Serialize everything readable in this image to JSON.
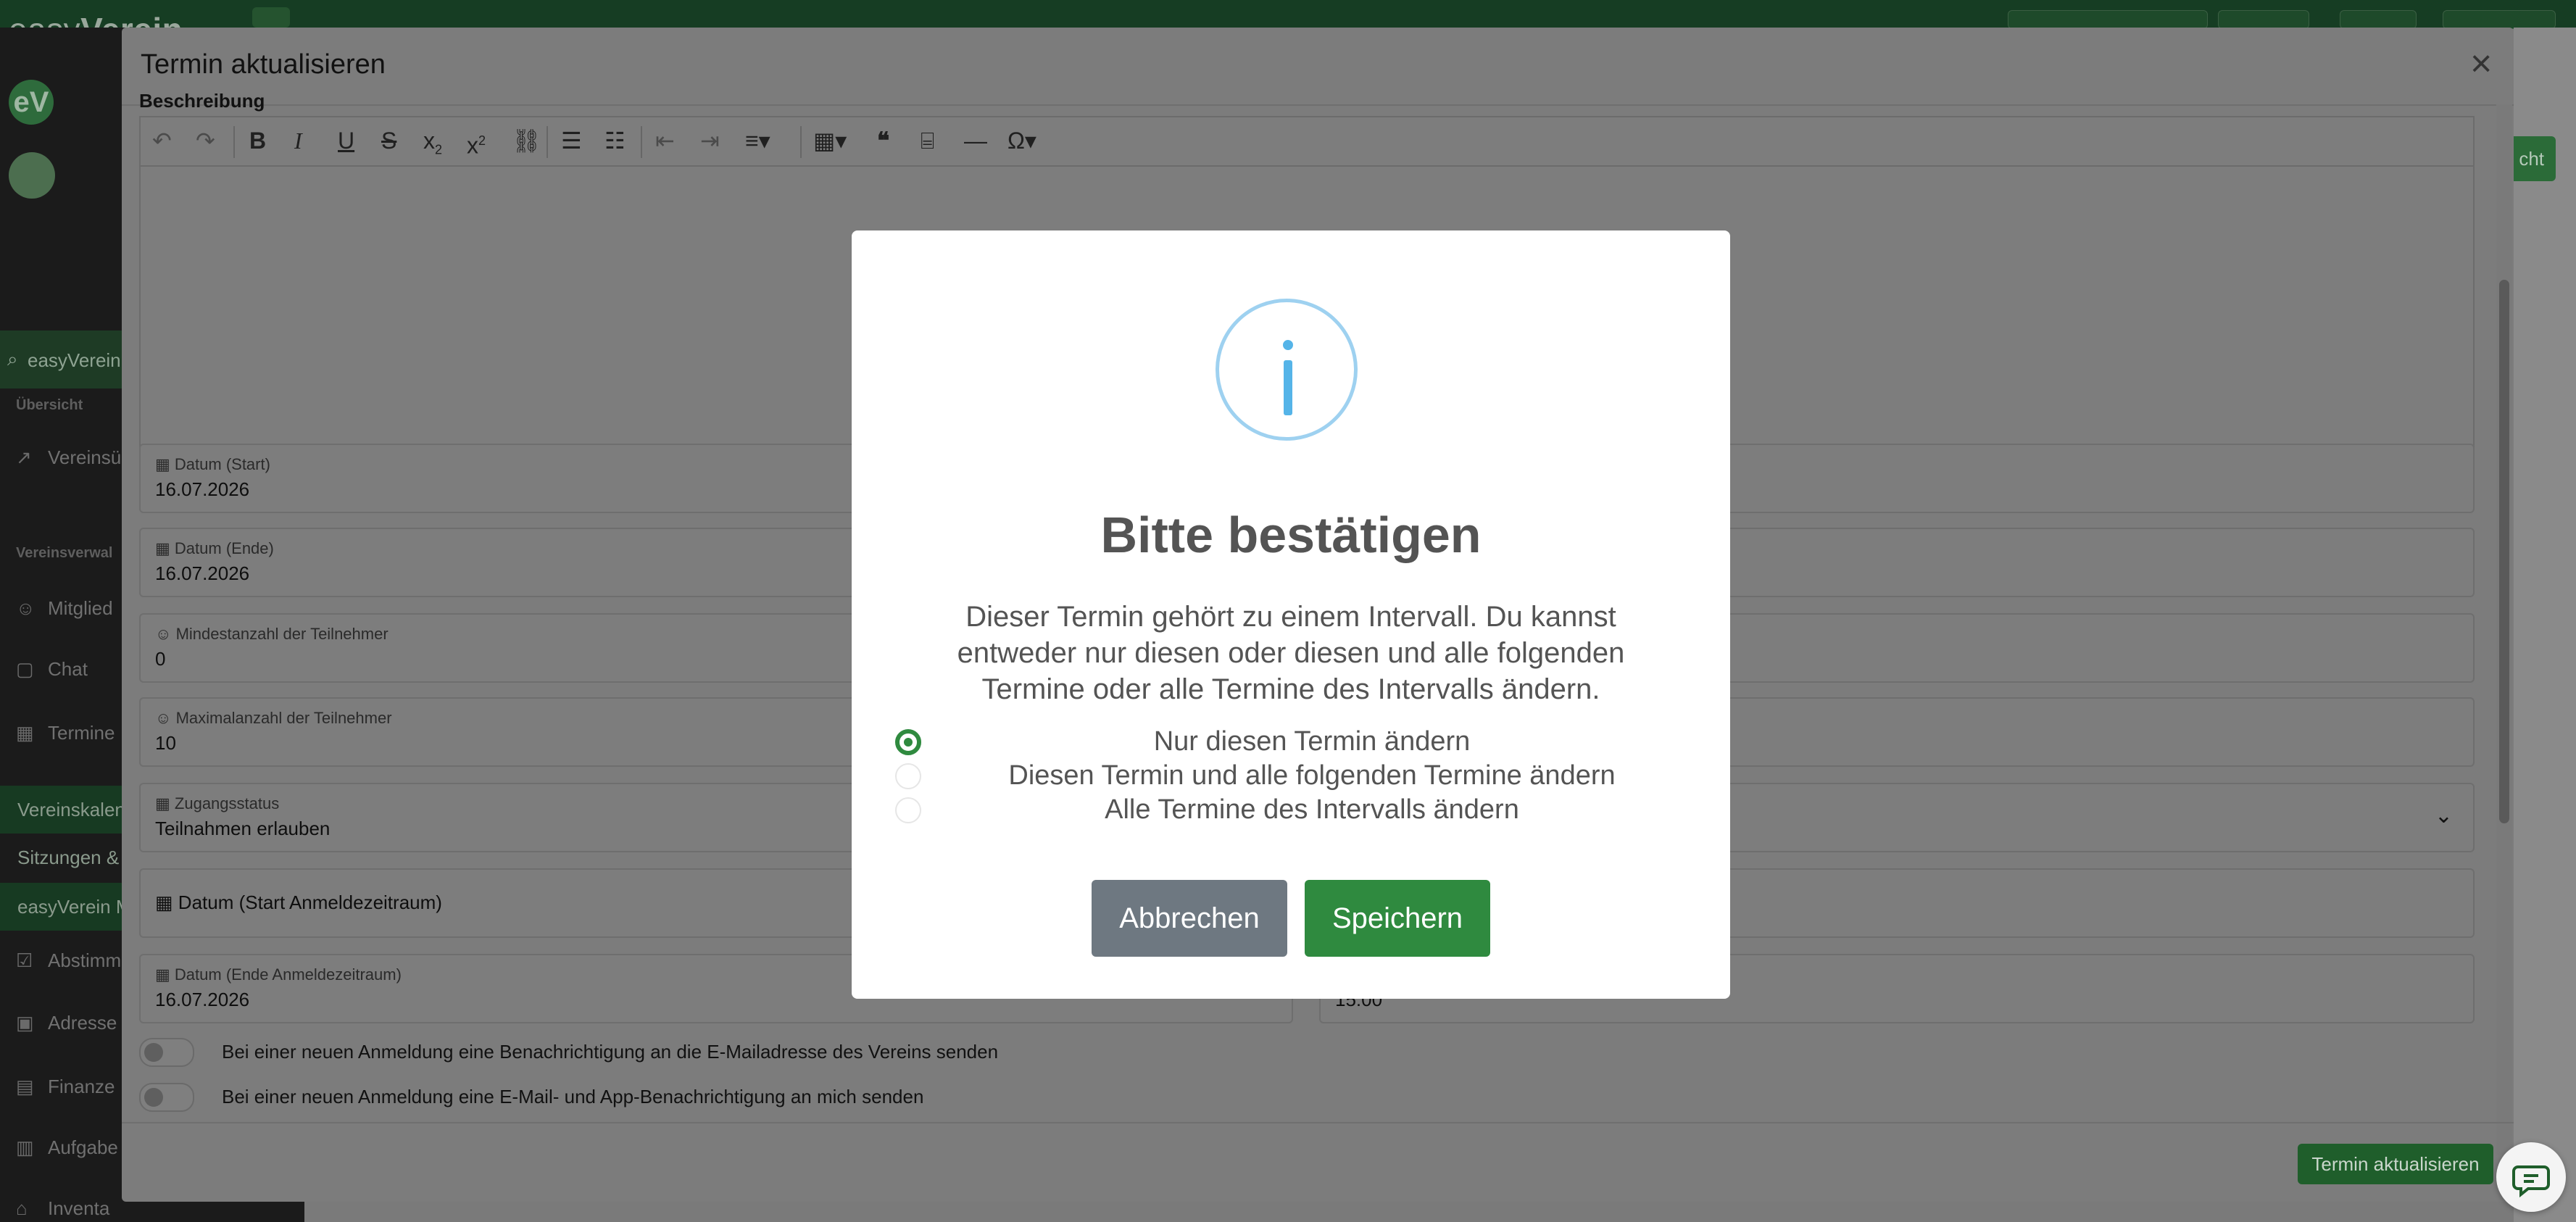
{
  "app": {
    "brand_light": "easy",
    "brand_bold": "Verein"
  },
  "modal": {
    "title": "Termin aktualisieren",
    "close_icon": "×",
    "description_label": "Beschreibung",
    "fields": {
      "date_start": {
        "label": "Datum (Start)",
        "value": "16.07.2026"
      },
      "date_end": {
        "label": "Datum (Ende)",
        "value": "16.07.2026"
      },
      "min_participants": {
        "label": "Mindestanzahl der Teilnehmer",
        "value": "0"
      },
      "max_participants": {
        "label": "Maximalanzahl der Teilnehmer",
        "value": "10"
      },
      "access_status": {
        "label": "Zugangsstatus",
        "value": "Teilnahmen erlauben"
      },
      "registration_start": {
        "label": "Datum (Start Anmeldezeitraum)"
      },
      "registration_end": {
        "label": "Datum (Ende Anmeldezeitraum)",
        "value": "16.07.2026"
      },
      "registration_end_time": {
        "value": "15:00"
      }
    },
    "toggles": [
      {
        "label": "Bei einer neuen Anmeldung eine Benachrichtigung an die E-Mailadresse des Vereins senden",
        "checked": false
      },
      {
        "label": "Bei einer neuen Anmeldung eine E-Mail- und App-Benachrichtigung an mich senden",
        "checked": false
      }
    ],
    "submit_label": "Termin aktualisieren"
  },
  "sidebar": {
    "section_overview": "Übersicht",
    "section_admin": "Vereinsverwal",
    "search_text": "easyVerein",
    "items": {
      "overview": "Vereinsübe",
      "members": "Mitglied",
      "chat": "Chat",
      "events": "Termine",
      "calendar": "Vereinskalen",
      "meetings": "Sitzungen &",
      "easyverein": "easyVerein M",
      "votes": "Abstimm",
      "addresses": "Adresse",
      "finance": "Finanze",
      "tasks": "Aufgabe",
      "inventory": "Inventa"
    }
  },
  "dialog": {
    "title": "Bitte bestätigen",
    "message": "Dieser Termin gehört zu einem Intervall. Du kannst entweder nur diesen oder diesen und alle folgenden Termine oder alle Termine des Intervalls ändern.",
    "options": [
      {
        "label": "Nur diesen Termin ändern",
        "selected": true
      },
      {
        "label": "Diesen Termin und alle folgenden Termine ändern",
        "selected": false
      },
      {
        "label": "Alle Termine des Intervalls ändern",
        "selected": false
      }
    ],
    "cancel_label": "Abbrechen",
    "save_label": "Speichern"
  },
  "colors": {
    "primary_green": "#2f8a3f",
    "cancel_gray": "#6e7881",
    "info_blue": "#55b4e8",
    "text_gray": "#545454"
  }
}
